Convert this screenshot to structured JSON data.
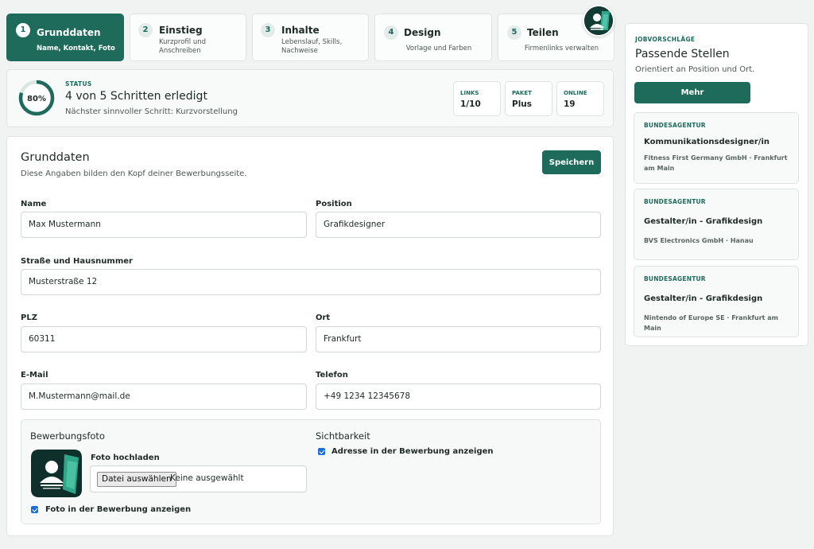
{
  "steps": [
    {
      "num": "1",
      "title": "Grunddaten",
      "sub": "Name, Kontakt, Foto"
    },
    {
      "num": "2",
      "title": "Einstieg",
      "sub": "Kurzprofil und Anschreiben"
    },
    {
      "num": "3",
      "title": "Inhalte",
      "sub": "Lebenslauf, Skills, Nachweise"
    },
    {
      "num": "4",
      "title": "Design",
      "sub": "Vorlage und Farben"
    },
    {
      "num": "5",
      "title": "Teilen",
      "sub": "Firmenlinks verwalten"
    }
  ],
  "status": {
    "label": "STATUS",
    "percent_text": "80%",
    "progress": 0.8,
    "headline": "4 von 5 Schritten erledigt",
    "hint": "Nächster sinnvoller Schritt: Kurzvorstellung",
    "stats": [
      {
        "key": "LINKS",
        "value": "1/10"
      },
      {
        "key": "PAKET",
        "value": "Plus"
      },
      {
        "key": "ONLINE",
        "value": "19"
      }
    ]
  },
  "form": {
    "title": "Grunddaten",
    "description": "Diese Angaben bilden den Kopf deiner Bewerbungsseite.",
    "save_label": "Speichern",
    "fields": {
      "name": {
        "label": "Name",
        "value": "Max Mustermann"
      },
      "position": {
        "label": "Position",
        "value": "Grafikdesigner"
      },
      "street": {
        "label": "Straße und Hausnummer",
        "value": "Musterstraße 12"
      },
      "plz": {
        "label": "PLZ",
        "value": "60311"
      },
      "city": {
        "label": "Ort",
        "value": "Frankfurt"
      },
      "email": {
        "label": "E-Mail",
        "value": "M.Mustermann@mail.de"
      },
      "phone": {
        "label": "Telefon",
        "value": "+49 1234 12345678"
      }
    },
    "photo": {
      "heading": "Bewerbungsfoto",
      "upload_label": "Foto hochladen",
      "file_button": "Datei auswählen",
      "file_status": "Keine ausgewählt",
      "show_photo_label": "Foto in der Bewerbung anzeigen",
      "show_photo_checked": true
    },
    "visibility": {
      "heading": "Sichtbarkeit",
      "show_address_label": "Adresse in der Bewerbung anzeigen",
      "show_address_checked": true
    }
  },
  "sidebar": {
    "kicker": "JOBVORSCHLÄGE",
    "title": "Passende Stellen",
    "subtitle": "Orientiert an Position und Ort.",
    "more_label": "Mehr",
    "jobs": [
      {
        "agency": "BUNDESAGENTUR",
        "title": "Kommunikationsdesigner/in",
        "company": "Fitness First Germany GmbH · Frankfurt am Main"
      },
      {
        "agency": "BUNDESAGENTUR",
        "title": "Gestalter/in - Grafikdesign",
        "company": "BVS Electronics GmbH · Hanau"
      },
      {
        "agency": "BUNDESAGENTUR",
        "title": "Gestalter/in - Grafikdesign",
        "company": "Nintendo of Europe SE · Frankfurt am Main"
      }
    ]
  },
  "colors": {
    "accent": "#1e6b5c",
    "checkbox": "#1a6fd8"
  },
  "icons": {
    "avatar": "user-avatar-icon",
    "photo": "profile-photo-icon"
  }
}
